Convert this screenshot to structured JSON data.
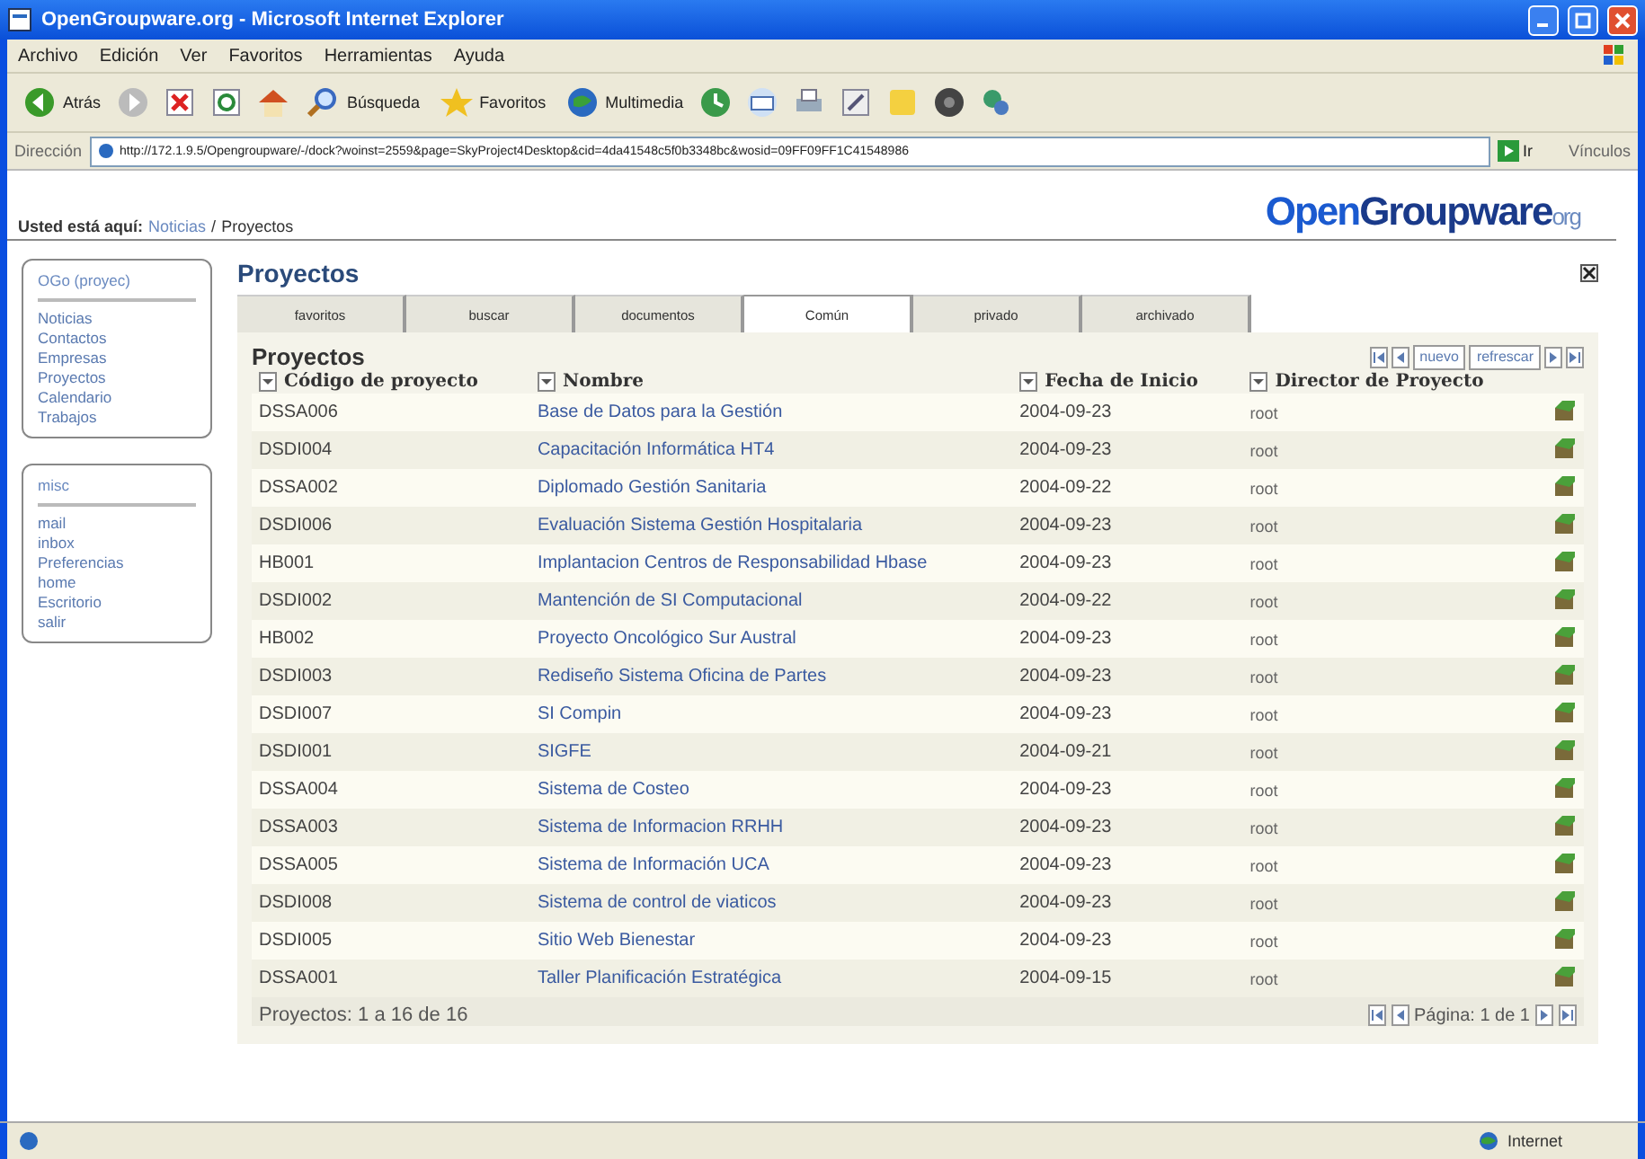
{
  "window": {
    "title": "OpenGroupware.org - Microsoft Internet Explorer"
  },
  "menu": [
    "Archivo",
    "Edición",
    "Ver",
    "Favoritos",
    "Herramientas",
    "Ayuda"
  ],
  "toolbar": [
    {
      "kind": "back",
      "label": "Atrás"
    },
    {
      "kind": "forward"
    },
    {
      "kind": "stop"
    },
    {
      "kind": "refresh"
    },
    {
      "kind": "home"
    },
    {
      "kind": "search",
      "label": "Búsqueda"
    },
    {
      "kind": "favorites",
      "label": "Favoritos"
    },
    {
      "kind": "media",
      "label": "Multimedia"
    },
    {
      "kind": "history"
    },
    {
      "kind": "mail"
    },
    {
      "kind": "print"
    },
    {
      "kind": "edit"
    },
    {
      "kind": "notes"
    },
    {
      "kind": "messenger"
    },
    {
      "kind": "tool"
    }
  ],
  "address": {
    "label": "Dirección",
    "url": "http://172.1.9.5/Opengroupware/-/dock?woinst=2559&page=SkyProject4Desktop&cid=4da41548c5f0b3348bc&wosid=09FF09FF1C41548986",
    "go": "Ir",
    "links": "Vínculos"
  },
  "breadcrumb": {
    "label": "Usted está aquí:",
    "crumbs": [
      {
        "text": "Noticias",
        "link": true
      },
      {
        "text": "Proyectos",
        "link": false
      }
    ],
    "separator": "/"
  },
  "logo": [
    "Open",
    "Groupware",
    "org"
  ],
  "sidebar": [
    {
      "title": "OGo (proyec)",
      "items": [
        "Noticias",
        "Contactos",
        "Empresas",
        "Proyectos",
        "Calendario",
        "Trabajos"
      ]
    },
    {
      "title": "misc",
      "items": [
        "mail",
        "inbox",
        "Preferencias",
        "home",
        "Escritorio",
        "salir"
      ]
    }
  ],
  "page_title": "Proyectos",
  "tabs": [
    {
      "label": "favoritos",
      "selected": false
    },
    {
      "label": "buscar",
      "selected": false
    },
    {
      "label": "documentos",
      "selected": false
    },
    {
      "label": "Común",
      "selected": true
    },
    {
      "label": "privado",
      "selected": false
    },
    {
      "label": "archivado",
      "selected": false
    }
  ],
  "panel": {
    "title": "Proyectos",
    "actions": [
      "nuevo",
      "refrescar"
    ],
    "columns": [
      "Código de proyecto",
      "Nombre",
      "Fecha de Inicio",
      "Director de Proyecto"
    ],
    "rows": [
      {
        "code": "DSSA006",
        "name": "Base de Datos para la Gestión",
        "date": "2004-09-23",
        "director": "root"
      },
      {
        "code": "DSDI004",
        "name": "Capacitación Informática HT4",
        "date": "2004-09-23",
        "director": "root"
      },
      {
        "code": "DSSA002",
        "name": "Diplomado Gestión Sanitaria",
        "date": "2004-09-22",
        "director": "root"
      },
      {
        "code": "DSDI006",
        "name": "Evaluación Sistema Gestión Hospitalaria",
        "date": "2004-09-23",
        "director": "root"
      },
      {
        "code": "HB001",
        "name": "Implantacion Centros de Responsabilidad Hbase",
        "date": "2004-09-23",
        "director": "root"
      },
      {
        "code": "DSDI002",
        "name": "Mantención de SI Computacional",
        "date": "2004-09-22",
        "director": "root"
      },
      {
        "code": "HB002",
        "name": "Proyecto Oncológico Sur Austral",
        "date": "2004-09-23",
        "director": "root"
      },
      {
        "code": "DSDI003",
        "name": "Rediseño Sistema Oficina de Partes",
        "date": "2004-09-23",
        "director": "root"
      },
      {
        "code": "DSDI007",
        "name": "SI Compin",
        "date": "2004-09-23",
        "director": "root"
      },
      {
        "code": "DSDI001",
        "name": "SIGFE",
        "date": "2004-09-21",
        "director": "root"
      },
      {
        "code": "DSSA004",
        "name": "Sistema de Costeo",
        "date": "2004-09-23",
        "director": "root"
      },
      {
        "code": "DSSA003",
        "name": "Sistema de Informacion RRHH",
        "date": "2004-09-23",
        "director": "root"
      },
      {
        "code": "DSSA005",
        "name": "Sistema de Información UCA",
        "date": "2004-09-23",
        "director": "root"
      },
      {
        "code": "DSDI008",
        "name": "Sistema de control de viaticos",
        "date": "2004-09-23",
        "director": "root"
      },
      {
        "code": "DSDI005",
        "name": "Sitio Web Bienestar",
        "date": "2004-09-23",
        "director": "root"
      },
      {
        "code": "DSSA001",
        "name": "Taller Planificación Estratégica",
        "date": "2004-09-15",
        "director": "root"
      }
    ],
    "count": "Proyectos: 1 a 16 de 16",
    "pager": "Página: 1 de 1"
  },
  "status_bar": {
    "zone": "Internet"
  }
}
